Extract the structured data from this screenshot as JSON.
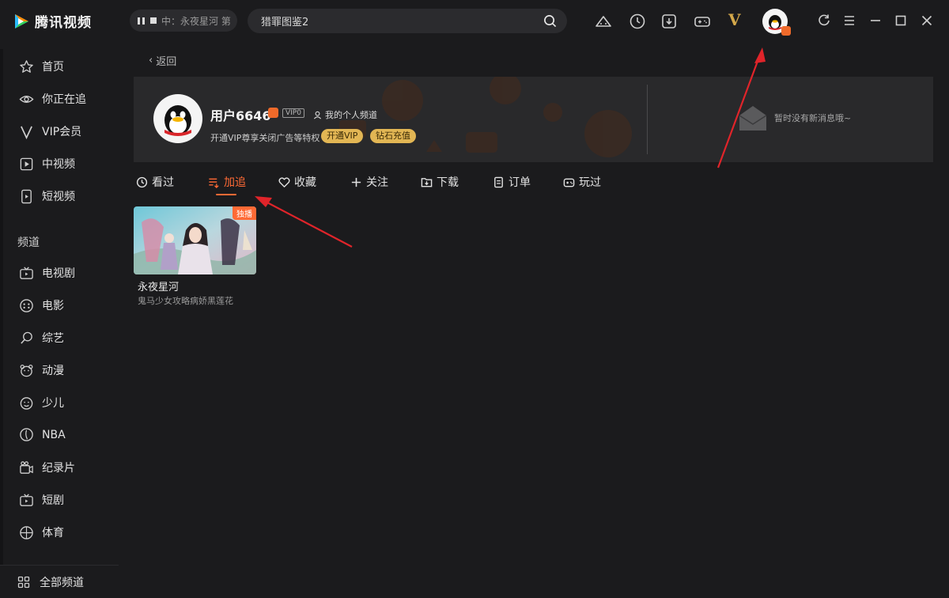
{
  "app": {
    "title": "腾讯视频"
  },
  "mini_player": {
    "text": "中：永夜星河 第"
  },
  "search": {
    "value": "猎罪图鉴2",
    "placeholder": "猎罪图鉴2"
  },
  "sidebar": {
    "items": [
      {
        "label": "首页",
        "icon": "star-icon"
      },
      {
        "label": "你正在追",
        "icon": "eye-icon"
      },
      {
        "label": "VIP会员",
        "icon": "vip-v-icon"
      },
      {
        "label": "中视频",
        "icon": "play-square-icon"
      },
      {
        "label": "短视频",
        "icon": "phone-play-icon"
      }
    ],
    "section_title": "频道",
    "channels": [
      {
        "label": "电视剧",
        "icon": "tv-icon"
      },
      {
        "label": "电影",
        "icon": "film-reel-icon"
      },
      {
        "label": "综艺",
        "icon": "mic-icon"
      },
      {
        "label": "动漫",
        "icon": "bear-icon"
      },
      {
        "label": "少儿",
        "icon": "kid-face-icon"
      },
      {
        "label": "NBA",
        "icon": "basketball-icon"
      },
      {
        "label": "纪录片",
        "icon": "camera-icon"
      },
      {
        "label": "短剧",
        "icon": "tv-small-icon"
      },
      {
        "label": "体育",
        "icon": "ball-icon"
      }
    ],
    "all_channels": "全部频道"
  },
  "main": {
    "back_label": "返回",
    "profile": {
      "username": "用户6646",
      "vip_level": "VIP0",
      "channel_link": "我的个人频道",
      "vip_hint": "开通VIP尊享关闭广告等特权",
      "open_vip": "开通VIP",
      "diamond_recharge": "钻石充值",
      "no_message": "暂时没有新消息哦~"
    },
    "tabs": [
      {
        "label": "看过"
      },
      {
        "label": "加追"
      },
      {
        "label": "收藏"
      },
      {
        "label": "关注"
      },
      {
        "label": "下载"
      },
      {
        "label": "订单"
      },
      {
        "label": "玩过"
      }
    ],
    "active_tab": "加追",
    "cards": [
      {
        "title": "永夜星河",
        "subtitle": "鬼马少女攻略病娇黑莲花",
        "tag": "独播"
      }
    ]
  },
  "colors": {
    "accent": "#ff6a35",
    "vip_gold": "#e2b654",
    "background": "#1b1b1d",
    "annotation_arrow": "#e0242a"
  }
}
